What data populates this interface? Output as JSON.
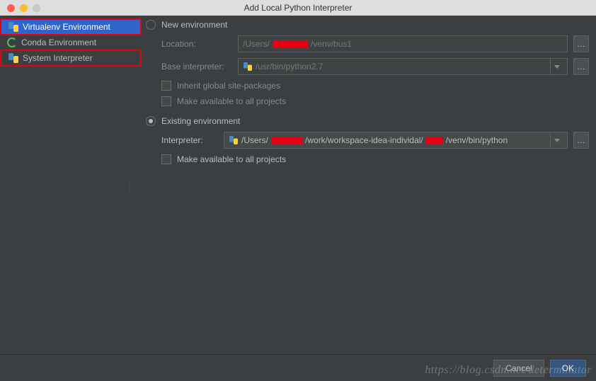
{
  "title": "Add Local Python Interpreter",
  "sidebar": {
    "items": [
      {
        "label": "Virtualenv Environment"
      },
      {
        "label": "Conda Environment"
      },
      {
        "label": "System Interpreter"
      }
    ]
  },
  "newEnv": {
    "radioLabel": "New environment",
    "locationLabel": "Location:",
    "locationPrefix": "/Users/",
    "locationSuffix": "/venv/bus1",
    "baseLabel": "Base interpreter:",
    "baseValue": "/usr/bin/python2.7",
    "inheritLabel": "Inherit global site-packages",
    "makeAvailLabel": "Make available to all projects"
  },
  "existingEnv": {
    "radioLabel": "Existing environment",
    "interpreterLabel": "Interpreter:",
    "pathPrefix": "/Users/",
    "pathMid": "/work/workspace-idea-individal/",
    "pathSuffix": "/venv/bin/python",
    "makeAvailLabel": "Make available to all projects"
  },
  "footer": {
    "cancel": "Cancel",
    "ok": "OK"
  },
  "watermark": "https://blog.csdn.net/determinator"
}
